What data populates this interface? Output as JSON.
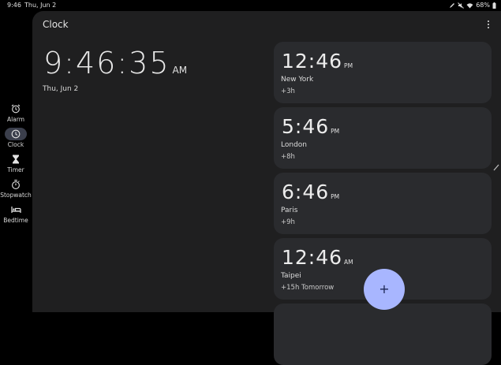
{
  "status_bar": {
    "time": "9:46",
    "date": "Thu, Jun 2",
    "battery": "68%",
    "icons": [
      "pen-icon",
      "mute-icon",
      "wifi-icon",
      "battery-icon"
    ]
  },
  "nav": {
    "items": [
      {
        "label": "Alarm",
        "icon": "alarm-icon",
        "active": false
      },
      {
        "label": "Clock",
        "icon": "clock-icon",
        "active": true
      },
      {
        "label": "Timer",
        "icon": "hourglass-icon",
        "active": false
      },
      {
        "label": "Stopwatch",
        "icon": "stopwatch-icon",
        "active": false
      },
      {
        "label": "Bedtime",
        "icon": "bed-icon",
        "active": false
      }
    ]
  },
  "header": {
    "title": "Clock",
    "menu_icon": "more-vert-icon"
  },
  "main_clock": {
    "time": "9:46:35",
    "ampm": "AM",
    "date": "Thu, Jun 2"
  },
  "cities": [
    {
      "time": "12:46",
      "ampm": "PM",
      "name": "New York",
      "offset": "+3h"
    },
    {
      "time": "5:46",
      "ampm": "PM",
      "name": "London",
      "offset": "+8h"
    },
    {
      "time": "6:46",
      "ampm": "PM",
      "name": "Paris",
      "offset": "+9h"
    },
    {
      "time": "12:46",
      "ampm": "AM",
      "name": "Taipei",
      "offset": "+15h Tomorrow"
    }
  ],
  "fab": {
    "label": "+",
    "icon": "add-icon"
  },
  "colors": {
    "background": "#000000",
    "panel": "#1f1f20",
    "card": "#2a2b2e",
    "active_pill": "#3b3f4c",
    "fab": "#a8b6ff"
  }
}
